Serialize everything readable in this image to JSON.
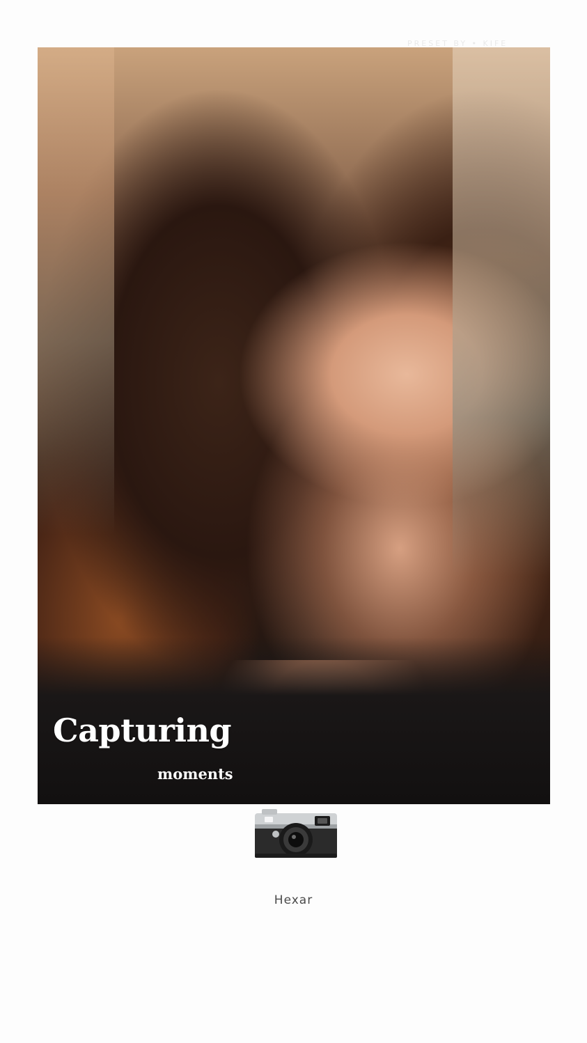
{
  "watermark": "PRESET BY • KIFE",
  "photo": {
    "headline": "Capturing",
    "subline": "moments"
  },
  "camera": {
    "icon": "camera-icon",
    "label": "Hexar"
  }
}
